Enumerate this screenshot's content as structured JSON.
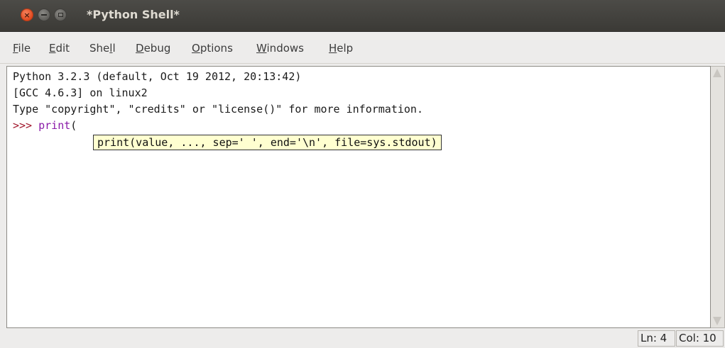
{
  "window": {
    "title": "*Python Shell*",
    "controls": {
      "close": "×",
      "minimize": "",
      "maximize": ""
    }
  },
  "menubar": {
    "items": [
      {
        "u": "F",
        "rest": "ile"
      },
      {
        "u": "E",
        "rest": "dit"
      },
      {
        "pre": "She",
        "u": "l",
        "rest": "l"
      },
      {
        "u": "D",
        "rest": "ebug"
      },
      {
        "u": "O",
        "rest": "ptions"
      },
      {
        "u": "W",
        "rest": "indows"
      },
      {
        "u": "H",
        "rest": "elp"
      }
    ]
  },
  "shell": {
    "lines": [
      "Python 3.2.3 (default, Oct 19 2012, 20:13:42)",
      "[GCC 4.6.3] on linux2",
      "Type \"copyright\", \"credits\" or \"license()\" for more information."
    ],
    "prompt": ">>> ",
    "input_func": "print",
    "input_rest": "(",
    "calltip": "print(value, ..., sep=' ', end='\\n', file=sys.stdout)"
  },
  "colors": {
    "prompt": "#a1162b",
    "builtin": "#8a1aa8",
    "calltip_bg": "#ffffd0"
  },
  "statusbar": {
    "line": "Ln: 4",
    "col": "Col: 10"
  }
}
